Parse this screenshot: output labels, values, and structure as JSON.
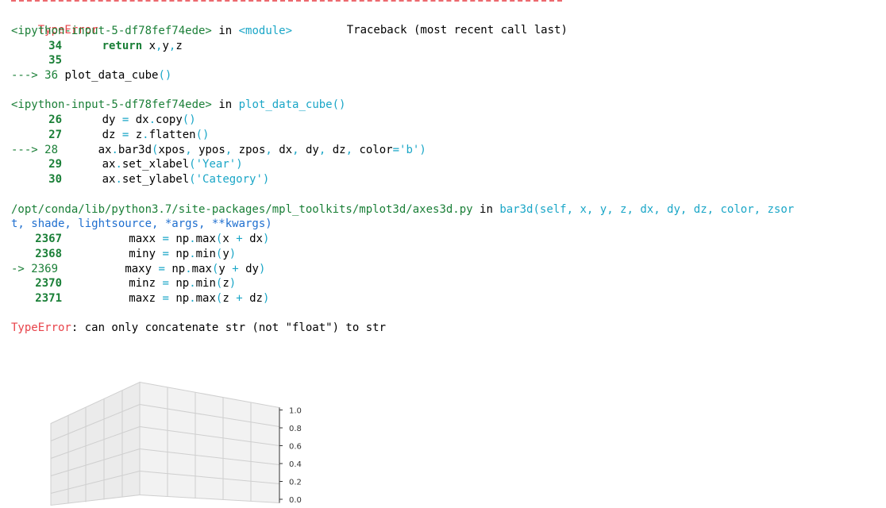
{
  "traceback": {
    "error_type": "TypeError",
    "header_right": "Traceback (most recent call last)",
    "frames": [
      {
        "location": "<ipython-input-5-df78fef74ede>",
        "in_text": "in",
        "func": "<module>",
        "lines": [
          {
            "num": "34",
            "code": "return x,y,z",
            "current": false
          },
          {
            "num": "35",
            "code": "",
            "current": false
          },
          {
            "num": "36",
            "code": "plot_data_cube()",
            "current": true
          }
        ]
      },
      {
        "location": "<ipython-input-5-df78fef74ede>",
        "in_text": "in",
        "func": "plot_data_cube()",
        "lines": [
          {
            "num": "26",
            "code": "dy = dx.copy()",
            "current": false
          },
          {
            "num": "27",
            "code": "dz = z.flatten()",
            "current": false
          },
          {
            "num": "28",
            "code": "ax.bar3d(xpos, ypos, zpos, dx, dy, dz, color='b')",
            "current": true
          },
          {
            "num": "29",
            "code": "ax.set_xlabel('Year')",
            "current": false
          },
          {
            "num": "30",
            "code": "ax.set_ylabel('Category')",
            "current": false
          }
        ]
      },
      {
        "location_line1": "/opt/conda/lib/python3.7/site-packages/mpl_toolkits/mplot3d/axes3d.py",
        "in_text": "in",
        "func_line1": "bar3d(self, x, y, z, dx, dy, dz, color, zsor",
        "func_line2": "t, shade, lightsource, *args, **kwargs)",
        "lines": [
          {
            "num": "2367",
            "code": "maxx = np.max(x + dx)",
            "current": false
          },
          {
            "num": "2368",
            "code": "miny = np.min(y)",
            "current": false
          },
          {
            "num": "2369",
            "code": "maxy = np.max(y + dy)",
            "current": true
          },
          {
            "num": "2370",
            "code": "minz = np.min(z)",
            "current": false
          },
          {
            "num": "2371",
            "code": "maxz = np.max(z + dz)",
            "current": false
          }
        ]
      }
    ],
    "final_error_type": "TypeError",
    "final_error_message": ": can only concatenate str (not \"float\") to str"
  },
  "arrows": {
    "frame_arrow": "--->",
    "lib_arrow": "->"
  },
  "plot": {
    "z_ticks": [
      "1.0",
      "0.8",
      "0.6",
      "0.4",
      "0.2",
      "0.0"
    ]
  },
  "colors": {
    "error": "#e8434a",
    "lineno": "#1a7f37",
    "func": "#1aa6c7",
    "args": "#1f6fcf"
  }
}
